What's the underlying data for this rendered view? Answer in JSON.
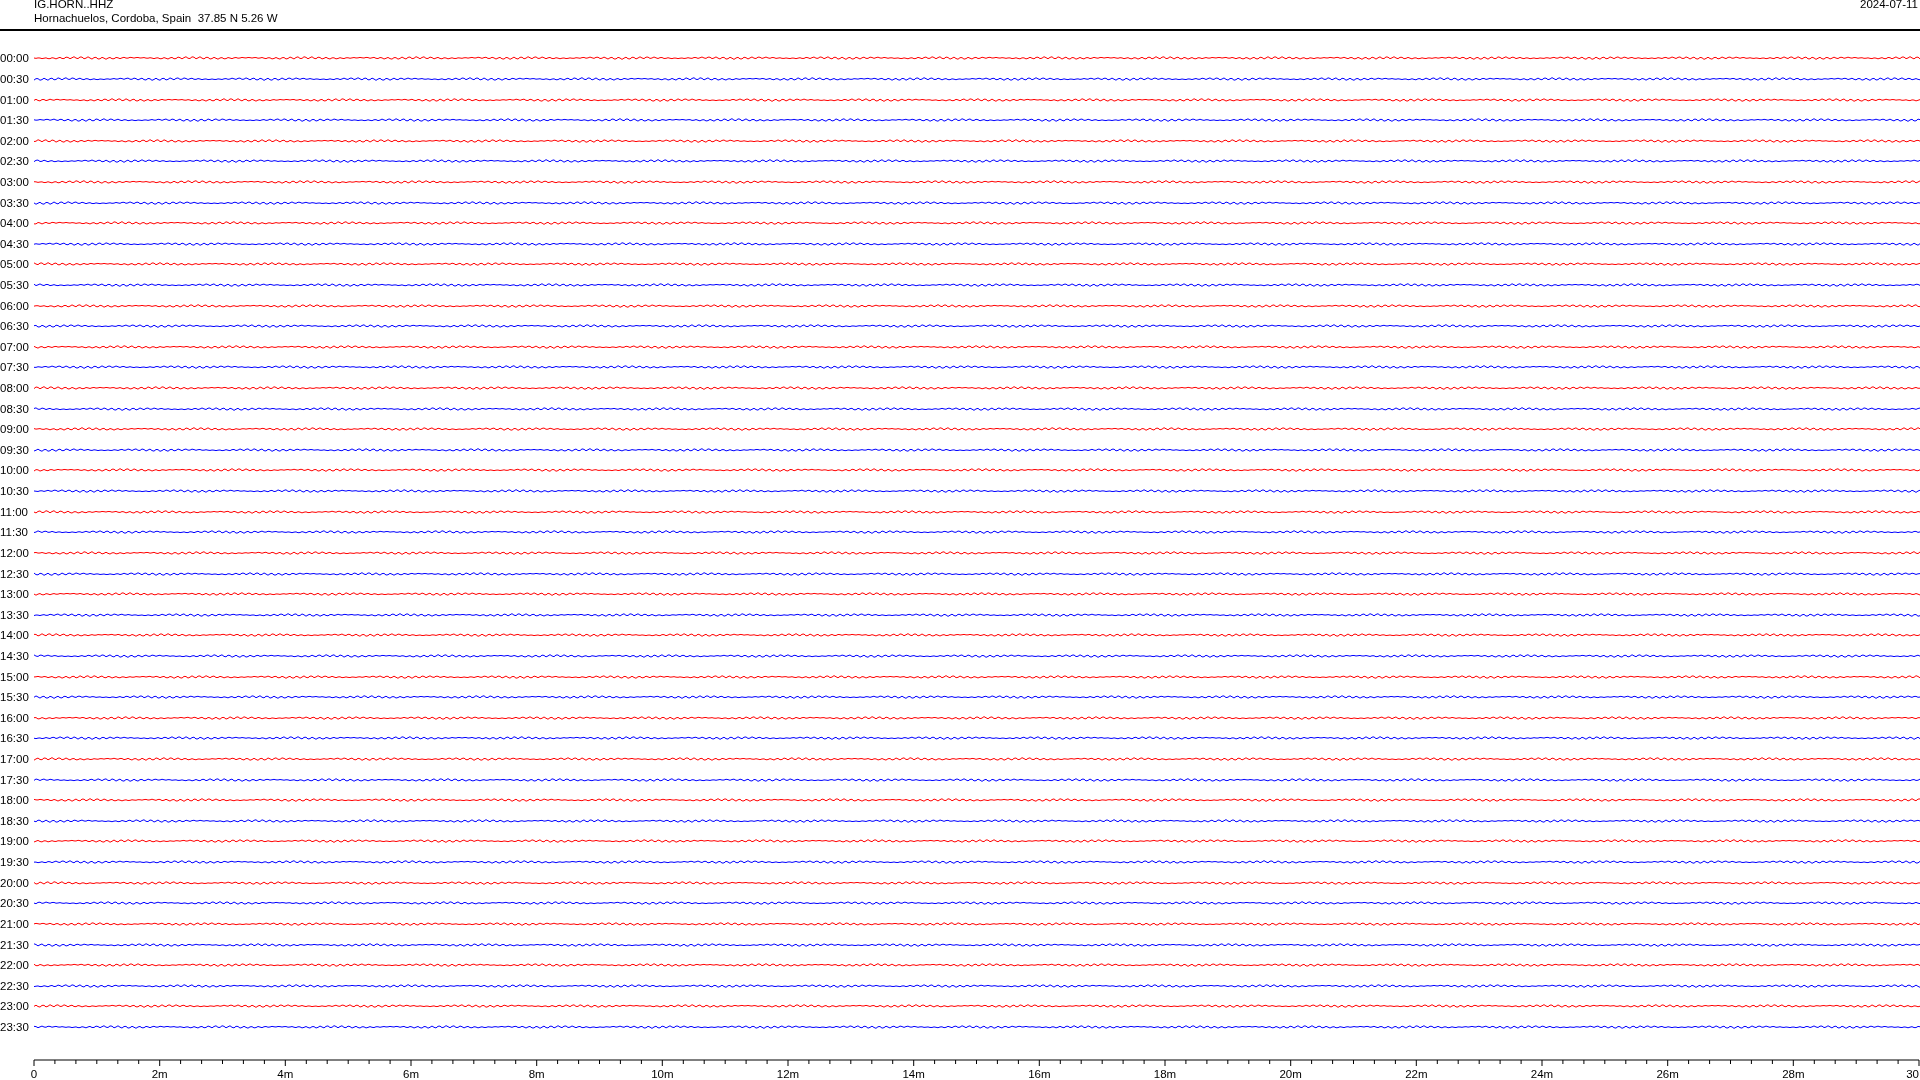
{
  "header": {
    "station": "IG.HORN..HHZ",
    "location": "Hornachuelos, Cordoba, Spain  37.85 N 5.26 W",
    "date": "2024-07-11"
  },
  "rows": [
    {
      "label": "00:00",
      "color": "#ff0000"
    },
    {
      "label": "00:30",
      "color": "#0000ff"
    },
    {
      "label": "01:00",
      "color": "#ff0000"
    },
    {
      "label": "01:30",
      "color": "#0000ff"
    },
    {
      "label": "02:00",
      "color": "#ff0000"
    },
    {
      "label": "02:30",
      "color": "#0000ff"
    },
    {
      "label": "03:00",
      "color": "#ff0000"
    },
    {
      "label": "03:30",
      "color": "#0000ff"
    },
    {
      "label": "04:00",
      "color": "#ff0000"
    },
    {
      "label": "04:30",
      "color": "#0000ff"
    },
    {
      "label": "05:00",
      "color": "#ff0000"
    },
    {
      "label": "05:30",
      "color": "#0000ff"
    },
    {
      "label": "06:00",
      "color": "#ff0000"
    },
    {
      "label": "06:30",
      "color": "#0000ff"
    },
    {
      "label": "07:00",
      "color": "#ff0000"
    },
    {
      "label": "07:30",
      "color": "#0000ff"
    },
    {
      "label": "08:00",
      "color": "#ff0000"
    },
    {
      "label": "08:30",
      "color": "#0000ff"
    },
    {
      "label": "09:00",
      "color": "#ff0000"
    },
    {
      "label": "09:30",
      "color": "#0000ff"
    },
    {
      "label": "10:00",
      "color": "#ff0000"
    },
    {
      "label": "10:30",
      "color": "#0000ff"
    },
    {
      "label": "11:00",
      "color": "#ff0000"
    },
    {
      "label": "11:30",
      "color": "#0000ff"
    },
    {
      "label": "12:00",
      "color": "#ff0000"
    },
    {
      "label": "12:30",
      "color": "#0000ff"
    },
    {
      "label": "13:00",
      "color": "#ff0000"
    },
    {
      "label": "13:30",
      "color": "#0000ff"
    },
    {
      "label": "14:00",
      "color": "#ff0000"
    },
    {
      "label": "14:30",
      "color": "#0000ff"
    },
    {
      "label": "15:00",
      "color": "#ff0000"
    },
    {
      "label": "15:30",
      "color": "#0000ff"
    },
    {
      "label": "16:00",
      "color": "#ff0000"
    },
    {
      "label": "16:30",
      "color": "#0000ff"
    },
    {
      "label": "17:00",
      "color": "#ff0000"
    },
    {
      "label": "17:30",
      "color": "#0000ff"
    },
    {
      "label": "18:00",
      "color": "#ff0000"
    },
    {
      "label": "18:30",
      "color": "#0000ff"
    },
    {
      "label": "19:00",
      "color": "#ff0000"
    },
    {
      "label": "19:30",
      "color": "#0000ff"
    },
    {
      "label": "20:00",
      "color": "#ff0000"
    },
    {
      "label": "20:30",
      "color": "#0000ff"
    },
    {
      "label": "21:00",
      "color": "#ff0000"
    },
    {
      "label": "21:30",
      "color": "#0000ff"
    },
    {
      "label": "22:00",
      "color": "#ff0000"
    },
    {
      "label": "22:30",
      "color": "#0000ff"
    },
    {
      "label": "23:00",
      "color": "#ff0000"
    },
    {
      "label": "23:30",
      "color": "#0000ff"
    }
  ],
  "axis": {
    "labels": [
      "0",
      "2m",
      "4m",
      "6m",
      "8m",
      "10m",
      "12m",
      "14m",
      "16m",
      "18m",
      "20m",
      "22m",
      "24m",
      "26m",
      "28m",
      "30"
    ]
  }
}
